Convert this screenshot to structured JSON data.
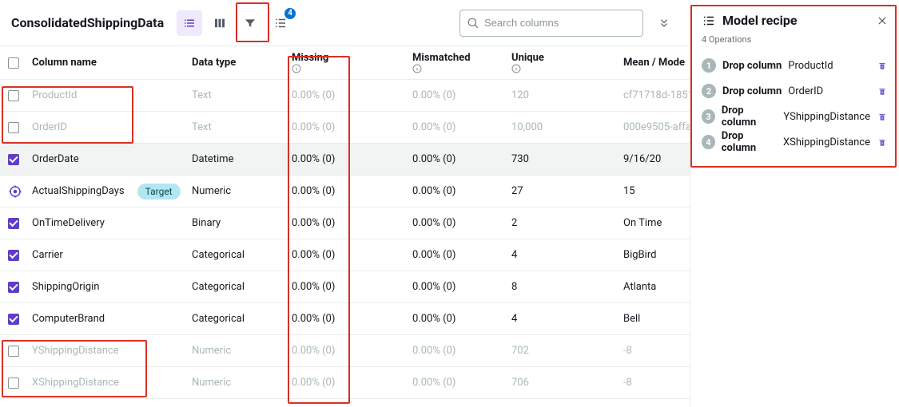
{
  "header": {
    "title": "ConsolidatedShippingData",
    "recipe_badge": "4"
  },
  "search": {
    "placeholder": "Search columns"
  },
  "columns": {
    "name": "Column name",
    "type": "Data type",
    "missing": "Missing",
    "mismatch": "Mismatched",
    "unique": "Unique",
    "mode": "Mean / Mode"
  },
  "target_tag": "Target",
  "rows": [
    {
      "name": "ProductId",
      "type": "Text",
      "missing": "0.00% (0)",
      "mismatch": "0.00% (0)",
      "unique": "120",
      "mode": "cf71718d-1851",
      "checked": false,
      "dropped": true
    },
    {
      "name": "OrderID",
      "type": "Text",
      "missing": "0.00% (0)",
      "mismatch": "0.00% (0)",
      "unique": "10,000",
      "mode": "000e9505-affa",
      "checked": false,
      "dropped": true
    },
    {
      "name": "OrderDate",
      "type": "Datetime",
      "missing": "0.00% (0)",
      "mismatch": "0.00% (0)",
      "unique": "730",
      "mode": "9/16/20",
      "checked": true,
      "dropped": false,
      "hover": true
    },
    {
      "name": "ActualShippingDays",
      "type": "Numeric",
      "missing": "0.00% (0)",
      "mismatch": "0.00% (0)",
      "unique": "27",
      "mode": "15",
      "checked": false,
      "dropped": false,
      "is_target": true
    },
    {
      "name": "OnTimeDelivery",
      "type": "Binary",
      "missing": "0.00% (0)",
      "mismatch": "0.00% (0)",
      "unique": "2",
      "mode": "On Time",
      "checked": true,
      "dropped": false
    },
    {
      "name": "Carrier",
      "type": "Categorical",
      "missing": "0.00% (0)",
      "mismatch": "0.00% (0)",
      "unique": "4",
      "mode": "BigBird",
      "checked": true,
      "dropped": false
    },
    {
      "name": "ShippingOrigin",
      "type": "Categorical",
      "missing": "0.00% (0)",
      "mismatch": "0.00% (0)",
      "unique": "8",
      "mode": "Atlanta",
      "checked": true,
      "dropped": false
    },
    {
      "name": "ComputerBrand",
      "type": "Categorical",
      "missing": "0.00% (0)",
      "mismatch": "0.00% (0)",
      "unique": "4",
      "mode": "Bell",
      "checked": true,
      "dropped": false
    },
    {
      "name": "YShippingDistance",
      "type": "Numeric",
      "missing": "0.00% (0)",
      "mismatch": "0.00% (0)",
      "unique": "702",
      "mode": "-8",
      "checked": false,
      "dropped": true
    },
    {
      "name": "XShippingDistance",
      "type": "Numeric",
      "missing": "0.00% (0)",
      "mismatch": "0.00% (0)",
      "unique": "706",
      "mode": "-8",
      "checked": false,
      "dropped": true
    }
  ],
  "recipe": {
    "title": "Model recipe",
    "sub": "4 Operations",
    "ops": [
      {
        "action": "Drop column",
        "col": "ProductId"
      },
      {
        "action": "Drop column",
        "col": "OrderID"
      },
      {
        "action": "Drop column",
        "col": "YShippingDistance"
      },
      {
        "action": "Drop column",
        "col": "XShippingDistance"
      }
    ]
  }
}
